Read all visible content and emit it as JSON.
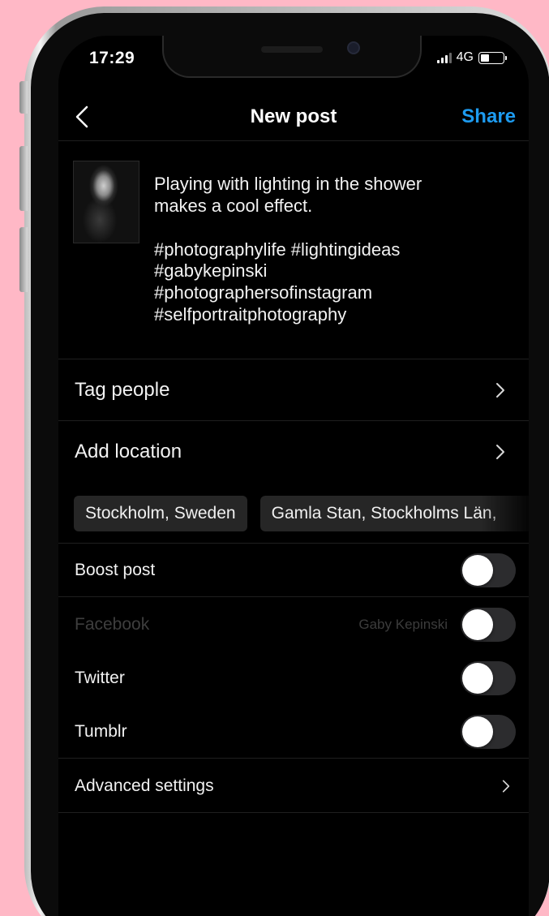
{
  "status_bar": {
    "time": "17:29",
    "network": "4G"
  },
  "header": {
    "title": "New post",
    "share_label": "Share",
    "share_color": "#1d9bf0"
  },
  "caption": {
    "lines": [
      "Playing with lighting in the shower",
      "makes a cool effect."
    ],
    "hashtags": [
      "#photographylife #lightingideas",
      "#gabykepinski",
      "#photographersofinstagram",
      "#selfportraitphotography"
    ]
  },
  "options": {
    "tag_people_label": "Tag people",
    "add_location_label": "Add location",
    "location_suggestions": [
      "Stockholm, Sweden",
      "Gamla Stan, Stockholms Län,"
    ]
  },
  "sharing": {
    "boost_post": {
      "label": "Boost post",
      "on": false
    },
    "facebook": {
      "label": "Facebook",
      "account": "Gaby Kepinski",
      "on": false,
      "disabled": true
    },
    "twitter": {
      "label": "Twitter",
      "on": false
    },
    "tumblr": {
      "label": "Tumblr",
      "on": false
    }
  },
  "advanced_settings_label": "Advanced settings"
}
